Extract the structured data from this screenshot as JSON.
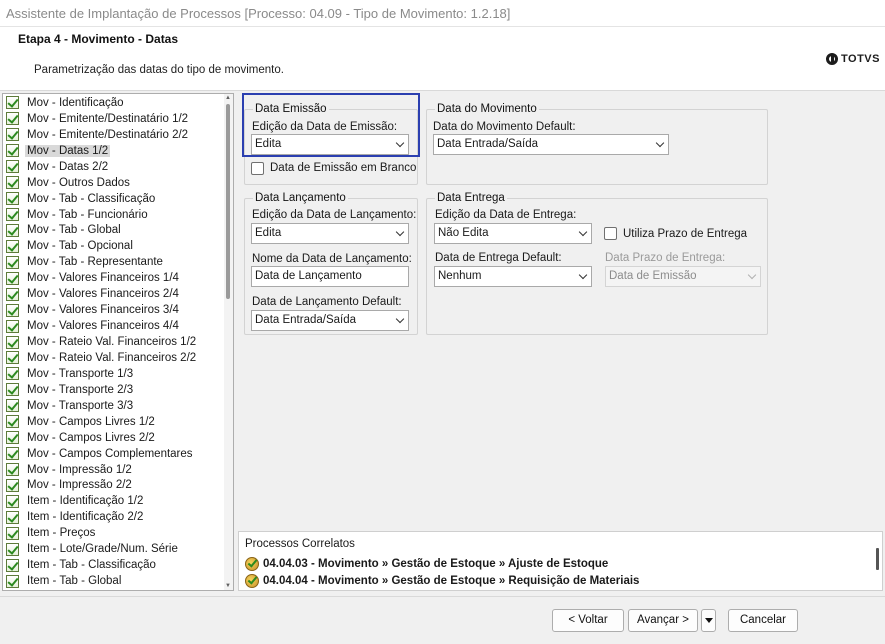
{
  "window": {
    "title": "Assistente de Implantação de Processos [Processo: 04.09 - Tipo de Movimento: 1.2.18]"
  },
  "header": {
    "step": "Etapa 4 - Movimento - Datas",
    "description": "Parametrização das datas do tipo de movimento.",
    "logo_text": "TOTVS"
  },
  "tree": {
    "items": [
      {
        "label": "Mov - Identificação"
      },
      {
        "label": "Mov - Emitente/Destinatário 1/2"
      },
      {
        "label": "Mov - Emitente/Destinatário 2/2"
      },
      {
        "label": "Mov - Datas 1/2",
        "selected": true
      },
      {
        "label": "Mov - Datas 2/2"
      },
      {
        "label": "Mov - Outros Dados"
      },
      {
        "label": "Mov - Tab - Classificação"
      },
      {
        "label": "Mov - Tab - Funcionário"
      },
      {
        "label": "Mov - Tab - Global"
      },
      {
        "label": "Mov - Tab - Opcional"
      },
      {
        "label": "Mov - Tab - Representante"
      },
      {
        "label": "Mov - Valores Financeiros 1/4"
      },
      {
        "label": "Mov - Valores Financeiros 2/4"
      },
      {
        "label": "Mov - Valores Financeiros 3/4"
      },
      {
        "label": "Mov - Valores Financeiros 4/4"
      },
      {
        "label": "Mov - Rateio Val. Financeiros 1/2"
      },
      {
        "label": "Mov - Rateio Val. Financeiros 2/2"
      },
      {
        "label": "Mov - Transporte 1/3"
      },
      {
        "label": "Mov - Transporte 2/3"
      },
      {
        "label": "Mov - Transporte 3/3"
      },
      {
        "label": "Mov - Campos Livres 1/2"
      },
      {
        "label": "Mov - Campos Livres 2/2"
      },
      {
        "label": "Mov - Campos Complementares"
      },
      {
        "label": "Mov - Impressão 1/2"
      },
      {
        "label": "Mov - Impressão 2/2"
      },
      {
        "label": "Item - Identificação 1/2"
      },
      {
        "label": "Item - Identificação 2/2"
      },
      {
        "label": "Item - Preços"
      },
      {
        "label": "Item - Lote/Grade/Num. Série"
      },
      {
        "label": "Item - Tab - Classificação"
      },
      {
        "label": "Item - Tab - Global"
      }
    ]
  },
  "emissao": {
    "legend": "Data Emissão",
    "edicao_label": "Edição da Data de Emissão:",
    "edicao_value": "Edita",
    "branco_label": "Data de Emissão em Branco"
  },
  "movimento": {
    "legend": "Data do Movimento",
    "default_label": "Data do Movimento Default:",
    "default_value": "Data Entrada/Saída"
  },
  "lancamento": {
    "legend": "Data Lançamento",
    "edicao_label": "Edição da Data de Lançamento:",
    "edicao_value": "Edita",
    "nome_label": "Nome da Data de Lançamento:",
    "nome_value": "Data de Lançamento",
    "default_label": "Data de Lançamento Default:",
    "default_value": "Data Entrada/Saída"
  },
  "entrega": {
    "legend": "Data Entrega",
    "edicao_label": "Edição da Data de Entrega:",
    "edicao_value": "Não Edita",
    "prazo_label": "Utiliza Prazo de Entrega",
    "default_label": "Data de Entrega Default:",
    "default_value": "Nenhum",
    "prazo_data_label": "Data Prazo de Entrega:",
    "prazo_data_value": "Data de Emissão"
  },
  "correlatos": {
    "title": "Processos Correlatos",
    "items": [
      {
        "text": "04.04.03 - Movimento » Gestão de Estoque » Ajuste de Estoque"
      },
      {
        "text": "04.04.04 - Movimento » Gestão de Estoque » Requisição de Materiais"
      }
    ]
  },
  "footer": {
    "back": "< Voltar",
    "next": "Avançar >",
    "cancel": "Cancelar"
  }
}
